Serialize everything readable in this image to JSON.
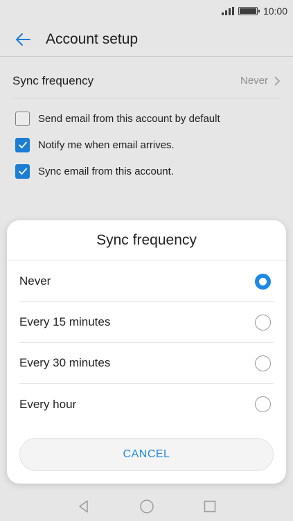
{
  "status_bar": {
    "time": "10:00",
    "signal_icon": "signal-icon",
    "battery_icon": "battery-icon"
  },
  "app_bar": {
    "title": "Account setup",
    "back_icon": "back-arrow-icon"
  },
  "settings": {
    "sync_frequency": {
      "label": "Sync frequency",
      "value": "Never"
    },
    "checkboxes": [
      {
        "label": "Send email from this account by default",
        "checked": false
      },
      {
        "label": "Notify me when email arrives.",
        "checked": true
      },
      {
        "label": "Sync email from this account.",
        "checked": true
      }
    ]
  },
  "dialog": {
    "title": "Sync frequency",
    "options": [
      {
        "label": "Never",
        "selected": true
      },
      {
        "label": "Every 15 minutes",
        "selected": false
      },
      {
        "label": "Every 30 minutes",
        "selected": false
      },
      {
        "label": "Every hour",
        "selected": false
      }
    ],
    "cancel_label": "CANCEL"
  },
  "nav_bar": {
    "icons": [
      "back-triangle-icon",
      "home-circle-icon",
      "recents-square-icon"
    ]
  },
  "colors": {
    "accent": "#1e88e5"
  }
}
